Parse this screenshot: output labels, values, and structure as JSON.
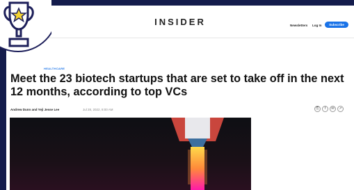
{
  "header": {
    "brand": "INSIDER",
    "newsletters": "Newsletters",
    "login": "Log In",
    "subscribe": "Subscribe"
  },
  "article": {
    "category": "HEALTHCARE",
    "headline": "Meet the 23 biotech startups that are set to take off in the next 12 months, according to top VCs",
    "authors": "Andrew Dunn and Yeji Jesse Lee",
    "date": "Jul 28, 2022, 8:00 AM"
  },
  "share_icons": [
    "link-icon",
    "facebook-icon",
    "email-icon",
    "share-icon"
  ],
  "colors": {
    "accent": "#1a73e8",
    "frame": "#141c4c",
    "rocket_flame": "#ff1aa8"
  },
  "overlay": {
    "icon": "trophy-icon"
  }
}
